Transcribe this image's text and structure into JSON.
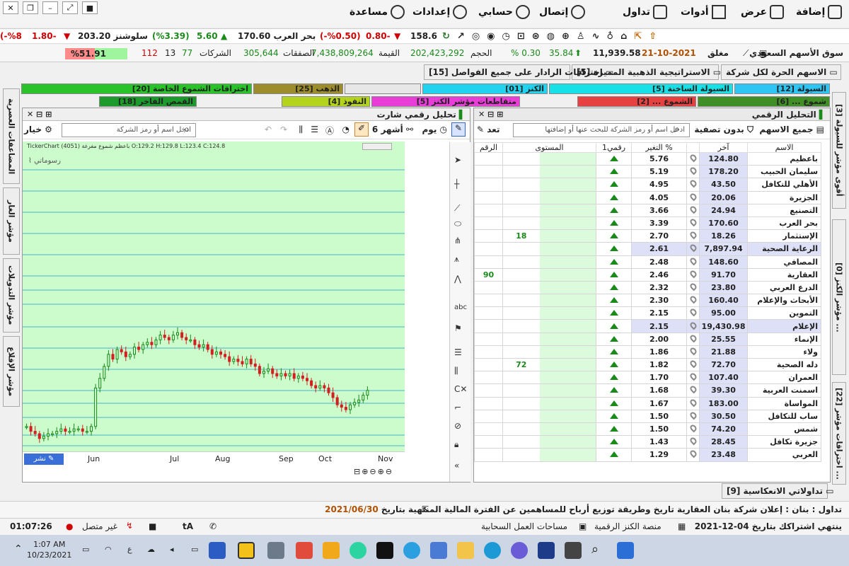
{
  "menu": {
    "add": "إضافة",
    "view": "عرض",
    "tools": "أدوات",
    "trade": "تداول",
    "contact": "إتصال",
    "account": "حسابي",
    "settings": "إعدادات",
    "help": "مساعدة"
  },
  "ticker": [
    {
      "text": "(-%8",
      "cls": "red"
    },
    {
      "text": "1.80-",
      "cls": "red"
    },
    {
      "text": "203.20 سلوشنز",
      "cls": ""
    },
    {
      "text": "(%3.39)",
      "cls": "grn"
    },
    {
      "text": "5.60",
      "cls": "grn"
    },
    {
      "text": "170.60 بحر العرب",
      "cls": ""
    },
    {
      "text": "(-%0.50)",
      "cls": "red"
    },
    {
      "text": "0.80-",
      "cls": "red"
    },
    {
      "text": "158.6",
      "cls": ""
    }
  ],
  "index_bar": {
    "market": "سوق الأسهم السعودي",
    "status": "مغلق",
    "date": "21-10-2021",
    "index": "11,939.58",
    "change": "35.84",
    "change_pct": "% 0.30",
    "volume_label": "الحجم",
    "volume": "202,423,292",
    "value_label": "القيمة",
    "value": "7,438,809,264",
    "deals_label": "الصفقات",
    "deals": "305,644",
    "companies_label": "الشركات",
    "up": "77",
    "flat": "13",
    "down": "112",
    "up_pct": "%51.91"
  },
  "top_tabs": [
    "الاسهم الحرة لكل شركة",
    "الاستراتيجية الذهبية المميزة [5]",
    "اختراقات الرادار على جميع الفواصل [15]"
  ],
  "color_tabs_row1": [
    {
      "label": "السيولة [12]",
      "color": "#2ec5f5"
    },
    {
      "label": "السيولة الساخنة [5]",
      "color": "#17e0e6"
    },
    {
      "label": "الكنز [01]",
      "color": "#22d3f0"
    },
    {
      "label": "",
      "color": "#e7e7e7"
    },
    {
      "label": "الذهب [25]",
      "color": "#9c8c2c"
    },
    {
      "label": "اختراقات الشموع الخاصة [20]",
      "color": "#29c229"
    }
  ],
  "color_tabs_row2": [
    {
      "label": "شموع ... [6]",
      "color": "#3f8e26"
    },
    {
      "label": "الشموع ... [2]",
      "color": "#e64040"
    },
    {
      "label": "متقاطعات مؤشر الكنز [5]",
      "color": "#e83dd7"
    },
    {
      "label": "النفوذ [4]",
      "color": "#b4d31d"
    },
    {
      "label": "القمص الفاخر [18]",
      "color": "#1c9a2c"
    }
  ],
  "left_side_tabs": [
    "المضاعفات العصرية",
    "مؤشر الغار",
    "مؤشر التدويلات",
    "مؤشر الإقلاع"
  ],
  "right_side_tabs": [
    "[3] أقوى مؤشر للسيولة",
    "[0] مؤشر الكنز ...",
    "[22] اختراقات مؤشر ..."
  ],
  "right_panel": {
    "title": "التحليل الرقمي",
    "all_stocks": "جميع الاسهم",
    "no_filter": "بدون تصفية",
    "search_placeholder": "ادخل اسم أو رمز الشركة للبحث عنها أو إضافتها",
    "cols": {
      "name": "الاسم",
      "last": "آخر",
      "change_pct": "التغير %",
      "my_num": "رقمي1",
      "level": "المستوى",
      "sym": "الرقم"
    }
  },
  "rows": [
    {
      "name": "باعظيم",
      "last": "124.80",
      "chg": "5.76",
      "level": "",
      "sym": ""
    },
    {
      "name": "سليمان الحبيب",
      "last": "178.20",
      "chg": "5.19",
      "level": "",
      "sym": ""
    },
    {
      "name": "الأهلي للتكافل",
      "last": "43.50",
      "chg": "4.95",
      "level": "",
      "sym": ""
    },
    {
      "name": "الجزيرة",
      "last": "20.06",
      "chg": "4.05",
      "level": "",
      "sym": ""
    },
    {
      "name": "التصنيع",
      "last": "24.94",
      "chg": "3.66",
      "level": "",
      "sym": ""
    },
    {
      "name": "بحر العرب",
      "last": "170.60",
      "chg": "3.39",
      "level": "",
      "sym": ""
    },
    {
      "name": "الإستثمار",
      "last": "18.26",
      "chg": "2.70",
      "level": "18",
      "sym": ""
    },
    {
      "name": "الرعاية الصحية",
      "last": "7,897.94",
      "chg": "2.61",
      "level": "",
      "sym": ""
    },
    {
      "name": "المصافي",
      "last": "148.60",
      "chg": "2.48",
      "level": "",
      "sym": ""
    },
    {
      "name": "العقارية",
      "last": "91.70",
      "chg": "2.46",
      "level": "",
      "sym": "90"
    },
    {
      "name": "الدرع العربي",
      "last": "23.80",
      "chg": "2.32",
      "level": "",
      "sym": ""
    },
    {
      "name": "الأبحاث والإعلام",
      "last": "160.40",
      "chg": "2.30",
      "level": "",
      "sym": ""
    },
    {
      "name": "التموين",
      "last": "95.00",
      "chg": "2.15",
      "level": "",
      "sym": ""
    },
    {
      "name": "الإعلام",
      "last": "19,430.98",
      "chg": "2.15",
      "level": "",
      "sym": ""
    },
    {
      "name": "الإنماء",
      "last": "25.55",
      "chg": "2.00",
      "level": "",
      "sym": ""
    },
    {
      "name": "ولاء",
      "last": "21.88",
      "chg": "1.86",
      "level": "",
      "sym": ""
    },
    {
      "name": "دله الصحية",
      "last": "72.70",
      "chg": "1.82",
      "level": "72",
      "sym": ""
    },
    {
      "name": "العمران",
      "last": "107.40",
      "chg": "1.70",
      "level": "",
      "sym": ""
    },
    {
      "name": "اسمنت العربية",
      "last": "39.30",
      "chg": "1.68",
      "level": "",
      "sym": ""
    },
    {
      "name": "المواساة",
      "last": "183.00",
      "chg": "1.67",
      "level": "",
      "sym": ""
    },
    {
      "name": "ساب للتكافل",
      "last": "30.50",
      "chg": "1.50",
      "level": "",
      "sym": ""
    },
    {
      "name": "شمس",
      "last": "74.20",
      "chg": "1.50",
      "level": "",
      "sym": ""
    },
    {
      "name": "جزيرة تكافل",
      "last": "28.45",
      "chg": "1.43",
      "level": "",
      "sym": ""
    },
    {
      "name": "العربي",
      "last": "23.48",
      "chg": "1.29",
      "level": "",
      "sym": ""
    }
  ],
  "chart_panel": {
    "title": "تحليل رقمي شارت",
    "period": "6 أشهر",
    "interval": "يوم",
    "search_placeholder": "ادخل اسم أو رمز الشركة",
    "options": "خيار",
    "ohlc": "TickerChart (4051) باعظم شموع مفرغة O:129.2 H:129.8 L:123.4 C:124.8",
    "sub": "رسوماتي",
    "publish": "نشر",
    "months": [
      "Jun",
      "Jul",
      "Aug",
      "Sep",
      "Oct",
      "Nov"
    ]
  },
  "chart_data": {
    "type": "candlestick",
    "x_ticks": [
      "Jun",
      "Jul",
      "Aug",
      "Sep",
      "Oct",
      "Nov"
    ],
    "closes": [
      88,
      86,
      85,
      83,
      84,
      85,
      85,
      86,
      87,
      86,
      86,
      87,
      87,
      86,
      86,
      88,
      104,
      108,
      113,
      118,
      116,
      120,
      119,
      117,
      118,
      121,
      120,
      122,
      123,
      122,
      124,
      126,
      125,
      124,
      126,
      127,
      125,
      124,
      124,
      122,
      121,
      122,
      120,
      118,
      119,
      118,
      117,
      115,
      116,
      115,
      114,
      116,
      114,
      113,
      110,
      111,
      112,
      110,
      109,
      110,
      109,
      110,
      108,
      109,
      108,
      107,
      105,
      104,
      105,
      104,
      102,
      100,
      97,
      96,
      95,
      97,
      98,
      99,
      101,
      103
    ]
  },
  "bottom_tab": "تداولاتي الانعكاسية [9]",
  "news": {
    "prefix": "تداول : بنان : إعلان شركة بنان العقارية تاريخ وطريقة توزيع أرباح للمساهمين عن الفترة المالية المنتهية بتاريخ",
    "date": "2021/06/30"
  },
  "status": {
    "subscription": "ينتهي اشتراكك بتاريخ 04-12-2021",
    "platform": "منصة الكنز الرقمية",
    "cloud": "مساحات العمل السحابية",
    "connection": "غير متصل",
    "time": "01:07:26",
    "font": "tA"
  },
  "taskbar": {
    "time": "1:07 AM",
    "date": "10/23/2021",
    "lang": "ع"
  }
}
